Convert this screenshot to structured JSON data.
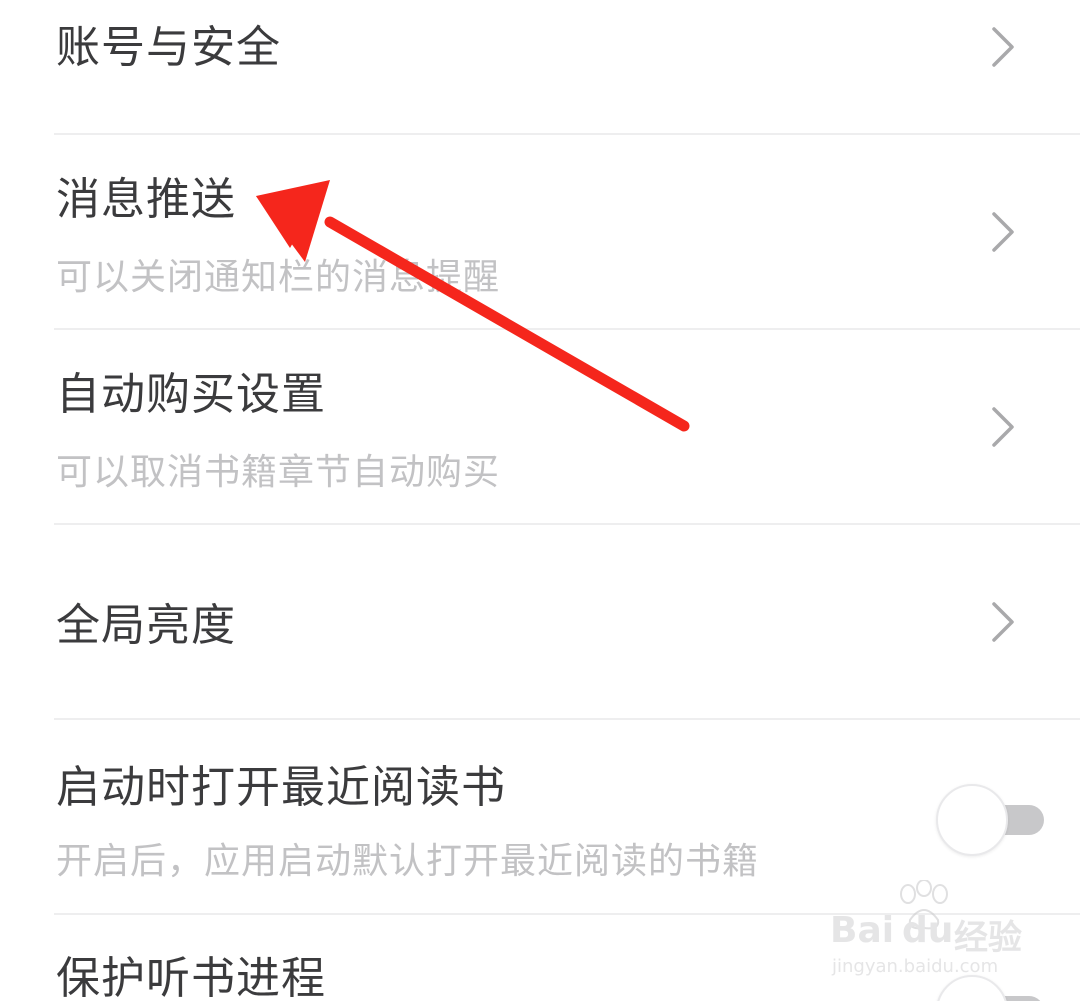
{
  "settings": {
    "items": [
      {
        "title": "账号与安全",
        "subtitle": ""
      },
      {
        "title": "消息推送",
        "subtitle": "可以关闭通知栏的消息提醒"
      },
      {
        "title": "自动购买设置",
        "subtitle": "可以取消书籍章节自动购买"
      },
      {
        "title": "全局亮度",
        "subtitle": ""
      },
      {
        "title": "启动时打开最近阅读书",
        "subtitle": "开启后，应用启动默认打开最近阅读的书籍"
      },
      {
        "title": "保护听书进程",
        "subtitle": ""
      }
    ]
  },
  "icons": {
    "chevron": "chevron-right-icon",
    "annotation": "red-arrow"
  },
  "colors": {
    "title_text": "#3b3b3d",
    "subtitle_text": "#c2c2c4",
    "divider": "#eeeeef",
    "arrow": "#f5261c",
    "toggle_track": "#c8c8ca"
  },
  "watermark": {
    "brand_left": "Bai",
    "brand_right": "du",
    "brand_cn": "经验",
    "url": "jingyan.baidu.com"
  }
}
